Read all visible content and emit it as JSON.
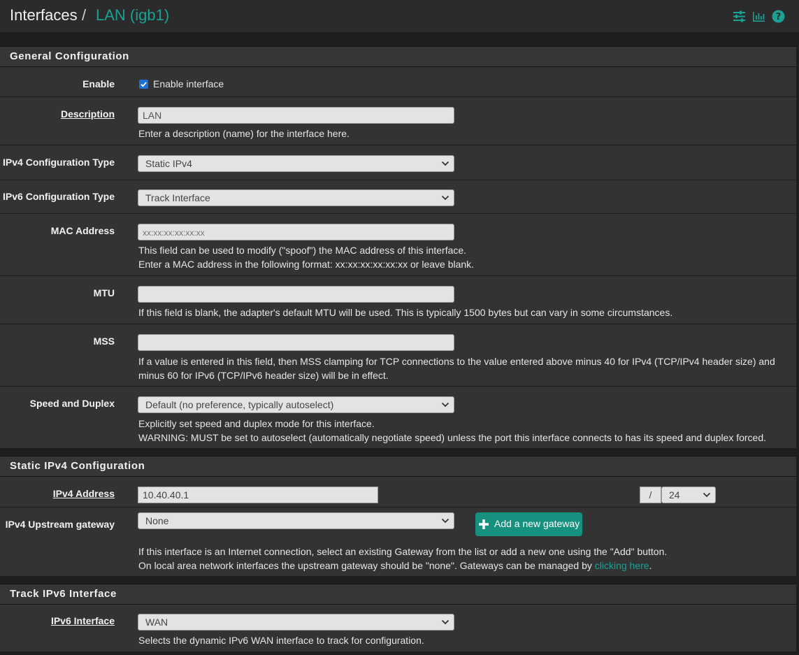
{
  "header": {
    "breadcrumb_root": "Interfaces",
    "breadcrumb_sep": "/",
    "breadcrumb_current": "LAN (igb1)",
    "icons": [
      "sliders-icon",
      "bar-chart-icon",
      "help-icon"
    ]
  },
  "colors": {
    "accent": "#1aa194",
    "button": "#16917f",
    "checkbox": "#1d6fd8"
  },
  "general": {
    "title": "General Configuration",
    "enable": {
      "label": "Enable",
      "checkbox_label": "Enable interface",
      "checked": true
    },
    "description": {
      "label": "Description",
      "value": "LAN",
      "help": "Enter a description (name) for the interface here."
    },
    "ipv4_type": {
      "label": "IPv4 Configuration Type",
      "value": "Static IPv4"
    },
    "ipv6_type": {
      "label": "IPv6 Configuration Type",
      "value": "Track Interface"
    },
    "mac": {
      "label": "MAC Address",
      "placeholder": "xx:xx:xx:xx:xx:xx",
      "help1": "This field can be used to modify (\"spoof\") the MAC address of this interface.",
      "help2": "Enter a MAC address in the following format: xx:xx:xx:xx:xx:xx or leave blank."
    },
    "mtu": {
      "label": "MTU",
      "value": "",
      "help": "If this field is blank, the adapter's default MTU will be used. This is typically 1500 bytes but can vary in some circumstances."
    },
    "mss": {
      "label": "MSS",
      "value": "",
      "help1": "If a value is entered in this field, then MSS clamping for TCP connections to the value entered above minus 40 for IPv4 (TCP/IPv4 header size) and",
      "help2": "minus 60 for IPv6 (TCP/IPv6 header size) will be in effect."
    },
    "speed": {
      "label": "Speed and Duplex",
      "value": "Default (no preference, typically autoselect)",
      "help1": "Explicitly set speed and duplex mode for this interface.",
      "help2": "WARNING: MUST be set to autoselect (automatically negotiate speed) unless the port this interface connects to has its speed and duplex forced."
    }
  },
  "static_ipv4": {
    "title": "Static IPv4 Configuration",
    "address": {
      "label": "IPv4 Address",
      "value": "10.40.40.1",
      "slash": "/",
      "prefix": "24"
    },
    "gateway": {
      "label": "IPv4 Upstream gateway",
      "value": "None",
      "add_button": "Add a new gateway",
      "help1": "If this interface is an Internet connection, select an existing Gateway from the list or add a new one using the \"Add\" button.",
      "help2_pre": "On local area network interfaces the upstream gateway should be \"none\". Gateways can be managed by ",
      "help2_link": "clicking here",
      "help2_post": "."
    }
  },
  "track_ipv6": {
    "title": "Track IPv6 Interface",
    "interface": {
      "label": "IPv6 Interface",
      "value": "WAN",
      "help": "Selects the dynamic IPv6 WAN interface to track for configuration."
    }
  }
}
